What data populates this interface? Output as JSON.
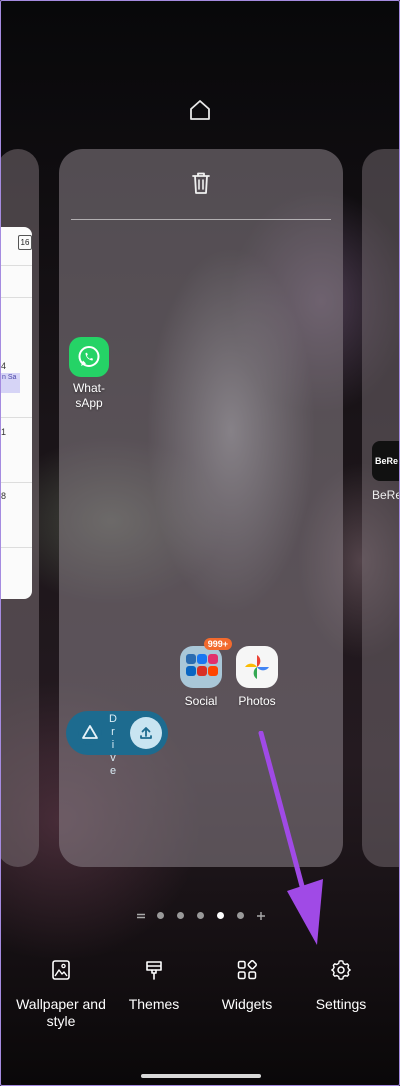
{
  "calendar": {
    "date_badge": "16",
    "day_numbers": [
      "4",
      "1",
      "8"
    ],
    "event_text": "n Sa"
  },
  "main_page": {
    "apps": [
      {
        "label": "What-\nsApp"
      },
      {
        "label": "Social",
        "badge": "999+"
      },
      {
        "label": "Photos"
      }
    ],
    "drive_widget": {
      "text": "D\nr\ni\nv\ne"
    }
  },
  "right_page": {
    "app_label": "BeRe",
    "icon_text": "BeRe"
  },
  "page_indicator": {
    "pages": 5,
    "active_index": 3
  },
  "bottom_menu": {
    "items": [
      {
        "label": "Wallpaper and style",
        "icon": "wallpaper-icon"
      },
      {
        "label": "Themes",
        "icon": "brush-icon"
      },
      {
        "label": "Widgets",
        "icon": "widgets-icon"
      },
      {
        "label": "Settings",
        "icon": "gear-icon"
      }
    ]
  },
  "colors": {
    "accent_arrow": "#a04ae6",
    "whatsapp": "#25d366",
    "drive": "#1d6b8f",
    "badge": "#f26a2e"
  }
}
